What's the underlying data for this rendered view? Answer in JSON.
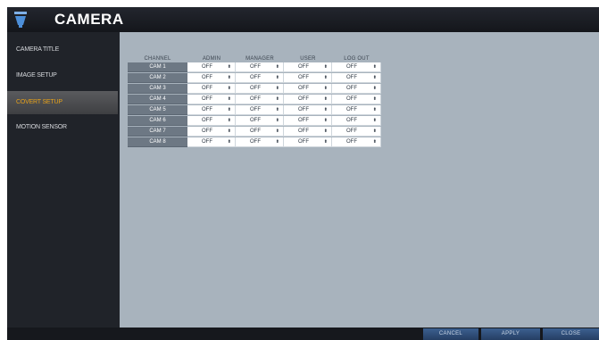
{
  "header": {
    "title": "CAMERA",
    "icon": "camera-icon"
  },
  "sidebar": {
    "items": [
      {
        "label": "CAMERA TITLE",
        "active": false
      },
      {
        "label": "IMAGE SETUP",
        "active": false
      },
      {
        "label": "COVERT SETUP",
        "active": true
      },
      {
        "label": "MOTION SENSOR",
        "active": false
      }
    ]
  },
  "table": {
    "headers": [
      "CHANNEL",
      "ADMIN",
      "MANAGER",
      "USER",
      "LOG OUT"
    ],
    "rows": [
      {
        "channel": "CAM 1",
        "values": [
          "OFF",
          "OFF",
          "OFF",
          "OFF"
        ]
      },
      {
        "channel": "CAM 2",
        "values": [
          "OFF",
          "OFF",
          "OFF",
          "OFF"
        ]
      },
      {
        "channel": "CAM 3",
        "values": [
          "OFF",
          "OFF",
          "OFF",
          "OFF"
        ]
      },
      {
        "channel": "CAM 4",
        "values": [
          "OFF",
          "OFF",
          "OFF",
          "OFF"
        ]
      },
      {
        "channel": "CAM 5",
        "values": [
          "OFF",
          "OFF",
          "OFF",
          "OFF"
        ]
      },
      {
        "channel": "CAM 6",
        "values": [
          "OFF",
          "OFF",
          "OFF",
          "OFF"
        ]
      },
      {
        "channel": "CAM 7",
        "values": [
          "OFF",
          "OFF",
          "OFF",
          "OFF"
        ]
      },
      {
        "channel": "CAM 8",
        "values": [
          "OFF",
          "OFF",
          "OFF",
          "OFF"
        ]
      }
    ],
    "arrow_glyph": "⬍"
  },
  "footer": {
    "cancel": "CANCEL",
    "apply": "APPLY",
    "close": "CLOSE"
  },
  "colors": {
    "accent": "#e6a11a",
    "button": "#2f4d77",
    "content_bg": "#a8b3bd"
  }
}
